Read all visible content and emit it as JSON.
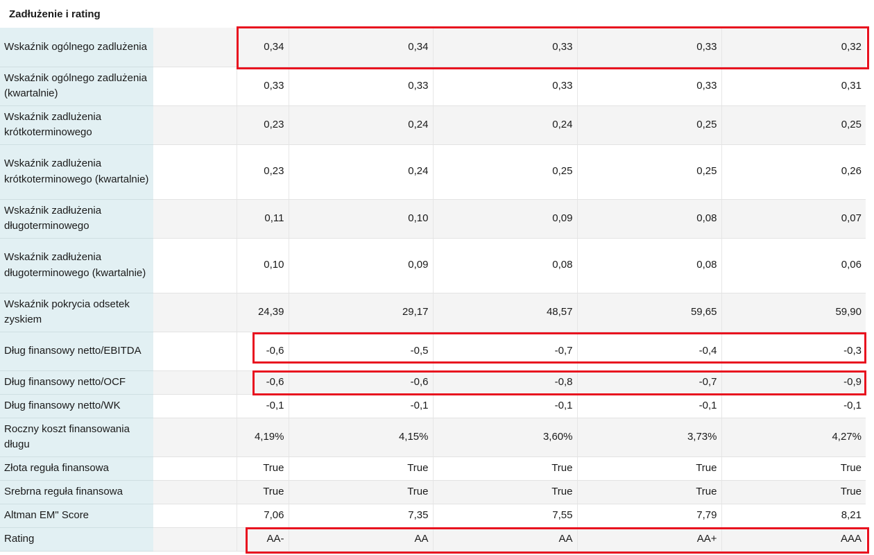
{
  "section": {
    "title": "Zadłużenie i rating"
  },
  "rows": [
    {
      "label": "Wskaźnik ogólnego zadlużenia",
      "values": [
        "0,34",
        "0,34",
        "0,33",
        "0,33",
        "0,32"
      ]
    },
    {
      "label": "Wskaźnik ogólnego zadlużenia (kwartalnie)",
      "values": [
        "0,33",
        "0,33",
        "0,33",
        "0,33",
        "0,31"
      ]
    },
    {
      "label": "Wskaźnik zadlużenia krótkoterminowego",
      "values": [
        "0,23",
        "0,24",
        "0,24",
        "0,25",
        "0,25"
      ]
    },
    {
      "label": "Wskaźnik zadlużenia krótkoterminowego (kwartalnie)",
      "values": [
        "0,23",
        "0,24",
        "0,25",
        "0,25",
        "0,26"
      ]
    },
    {
      "label": "Wskaźnik zadłużenia długoterminowego",
      "values": [
        "0,11",
        "0,10",
        "0,09",
        "0,08",
        "0,07"
      ]
    },
    {
      "label": "Wskaźnik zadłużenia długoterminowego (kwartalnie)",
      "values": [
        "0,10",
        "0,09",
        "0,08",
        "0,08",
        "0,06"
      ]
    },
    {
      "label": "Wskaźnik pokrycia odsetek zyskiem",
      "values": [
        "24,39",
        "29,17",
        "48,57",
        "59,65",
        "59,90"
      ]
    },
    {
      "label": "Dług finansowy netto/EBITDA",
      "values": [
        "-0,6",
        "-0,5",
        "-0,7",
        "-0,4",
        "-0,3"
      ]
    },
    {
      "label": "Dług finansowy netto/OCF",
      "values": [
        "-0,6",
        "-0,6",
        "-0,8",
        "-0,7",
        "-0,9"
      ]
    },
    {
      "label": "Dług finansowy netto/WK",
      "values": [
        "-0,1",
        "-0,1",
        "-0,1",
        "-0,1",
        "-0,1"
      ]
    },
    {
      "label": "Roczny koszt finansowania długu",
      "values": [
        "4,19%",
        "4,15%",
        "3,60%",
        "3,73%",
        "4,27%"
      ]
    },
    {
      "label": "Złota reguła finansowa",
      "values": [
        "True",
        "True",
        "True",
        "True",
        "True"
      ]
    },
    {
      "label": "Srebrna reguła finansowa",
      "values": [
        "True",
        "True",
        "True",
        "True",
        "True"
      ]
    },
    {
      "label": "Altman EM\" Score",
      "values": [
        "7,06",
        "7,35",
        "7,55",
        "7,79",
        "8,21"
      ]
    },
    {
      "label": "Rating",
      "values": [
        "AA-",
        "AA",
        "AA",
        "AA+",
        "AAA"
      ]
    }
  ],
  "highlight_color": "#e8121f"
}
